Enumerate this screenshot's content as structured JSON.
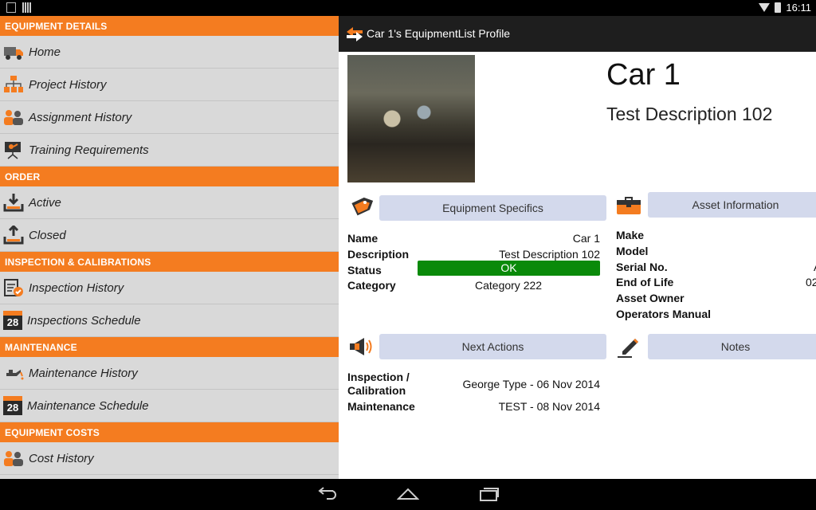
{
  "statusbar": {
    "time": "16:11"
  },
  "drawer": {
    "sections": [
      {
        "header": "EQUIPMENT DETAILS",
        "items": [
          {
            "label": "Home",
            "icon": "truck-icon"
          },
          {
            "label": "Project History",
            "icon": "org-chart-icon"
          },
          {
            "label": "Assignment History",
            "icon": "people-icon"
          },
          {
            "label": "Training Requirements",
            "icon": "presentation-icon"
          }
        ]
      },
      {
        "header": "ORDER",
        "items": [
          {
            "label": "Active",
            "icon": "download-tray-icon"
          },
          {
            "label": "Closed",
            "icon": "upload-tray-icon"
          }
        ]
      },
      {
        "header": "INSPECTION & CALIBRATIONS",
        "items": [
          {
            "label": "Inspection History",
            "icon": "clipboard-check-icon"
          },
          {
            "label": "Inspections Schedule",
            "icon": "calendar-icon",
            "cal": "28"
          }
        ]
      },
      {
        "header": "MAINTENANCE",
        "items": [
          {
            "label": "Maintenance History",
            "icon": "oil-can-icon"
          },
          {
            "label": "Maintenance Schedule",
            "icon": "calendar-icon",
            "cal": "28"
          }
        ]
      },
      {
        "header": "EQUIPMENT COSTS",
        "items": [
          {
            "label": "Cost History",
            "icon": "people-icon"
          }
        ]
      }
    ]
  },
  "topbar": {
    "title": "Car 1's EquipmentList Profile"
  },
  "profile": {
    "name": "Car 1",
    "description": "Test Description 102"
  },
  "specifics": {
    "button": "Equipment Specifics",
    "rows": [
      {
        "k": "Name",
        "v": "Car 1"
      },
      {
        "k": "Description",
        "v": "Test Description 102"
      },
      {
        "k": "Status",
        "v": "OK"
      },
      {
        "k": "Category",
        "v": "Category 222"
      }
    ]
  },
  "asset": {
    "button": "Asset Information",
    "rows": [
      {
        "k": "Make"
      },
      {
        "k": "Model"
      },
      {
        "k": "Serial No.",
        "v": "A"
      },
      {
        "k": "End of Life",
        "v": "02"
      },
      {
        "k": "Asset Owner"
      },
      {
        "k": "Operators Manual"
      }
    ]
  },
  "actions": {
    "button": "Next Actions",
    "rows": [
      {
        "k": "Inspection / Calibration",
        "k1": "Inspection /",
        "k2": "Calibration",
        "v": "George Type - 06 Nov 2014"
      },
      {
        "k": "Maintenance",
        "v": "TEST - 08 Nov 2014"
      }
    ]
  },
  "notes": {
    "button": "Notes"
  },
  "colors": {
    "accent": "#f47c20",
    "ok": "#0a8a0a",
    "button_bg": "#d3d9ec"
  }
}
